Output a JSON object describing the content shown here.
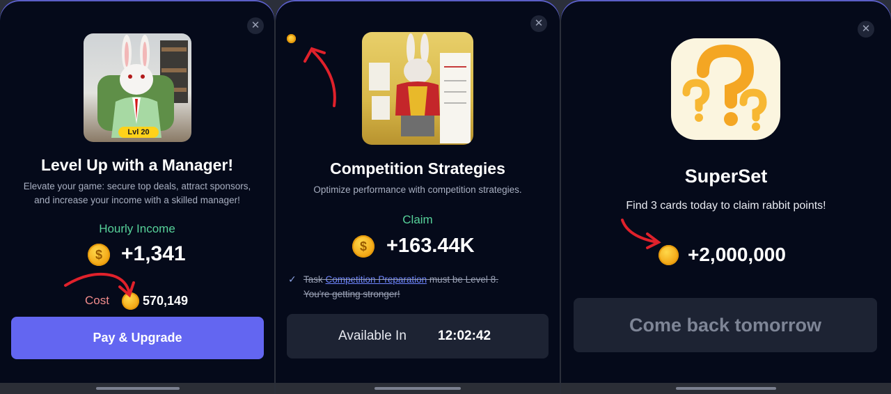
{
  "panel1": {
    "close_glyph": "✕",
    "badge": "Lvl 20",
    "title": "Level Up with a Manager!",
    "subtitle_line1": "Elevate your game: secure top deals, attract sponsors,",
    "subtitle_line2": "and increase your income with a skilled manager!",
    "income_label": "Hourly Income",
    "income_value": "+1,341",
    "cost_label": "Cost",
    "cost_value": "570,149",
    "button_label": "Pay & Upgrade",
    "accent": "#6366f1",
    "income_color": "#57d29a",
    "cost_color": "#f28c8c"
  },
  "panel2": {
    "close_glyph": "✕",
    "title": "Competition Strategies",
    "subtitle": "Optimize performance with competition strategies.",
    "claim_label": "Claim",
    "claim_value": "+163.44K",
    "task_prefix": "Task",
    "task_link": "Competition Preparation",
    "task_suffix": "must be Level 8.",
    "task_line2": "You're getting stronger!",
    "check_glyph": "✓",
    "available_label": "Available In",
    "timer": "12:02:42"
  },
  "panel3": {
    "close_glyph": "✕",
    "title": "SuperSet",
    "subtitle": "Find 3 cards today to claim rabbit points!",
    "reward_value": "+2,000,000",
    "button_label": "Come back tomorrow"
  },
  "icons": {
    "coin": "dollar-coin-icon",
    "close": "close-icon",
    "check": "check-icon"
  }
}
